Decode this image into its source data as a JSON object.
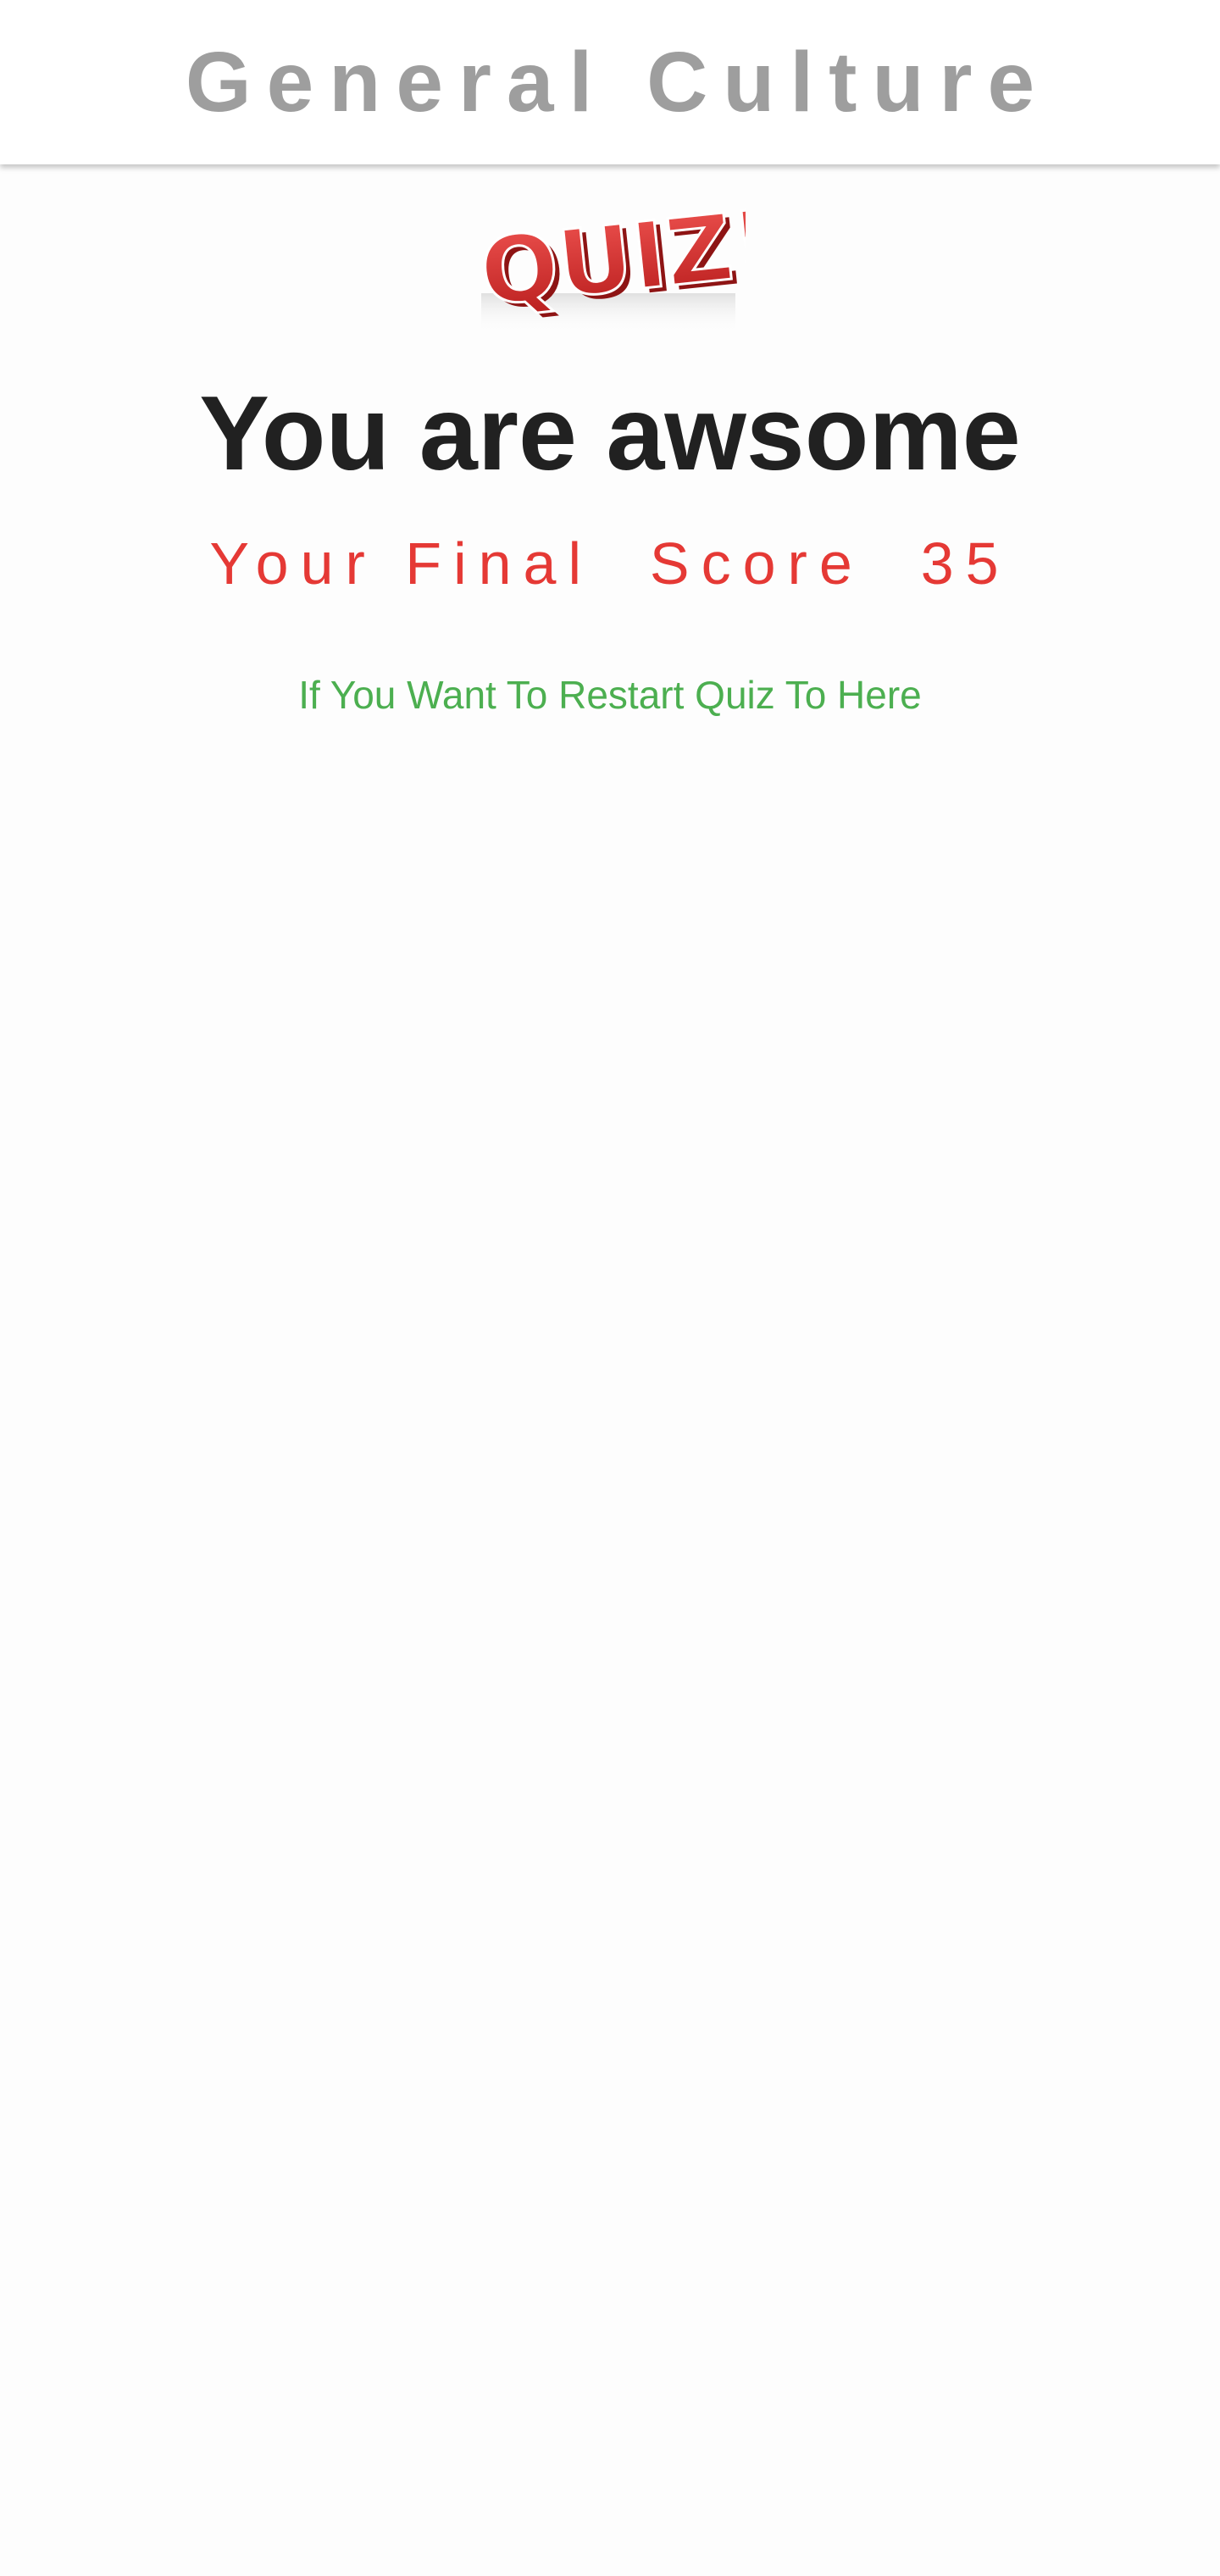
{
  "app_bar": {
    "title": "General Culture"
  },
  "logo": {
    "icon": "quiz-logo-icon",
    "text": "QUIZ!",
    "color": "#d32f2f"
  },
  "result": {
    "headline": "You are awsome",
    "score_label": "Your Final  Score",
    "score_value": "35",
    "restart_text": "If You Want To Restart Quiz To Here"
  },
  "colors": {
    "title": "#9e9e9e",
    "headline": "#212121",
    "score": "#e53935",
    "restart": "#4caf50"
  }
}
